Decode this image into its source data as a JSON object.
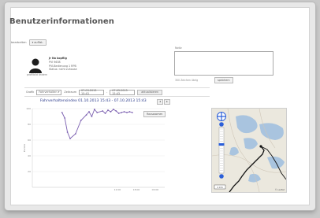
{
  "page": {
    "title": "Benutzerinformationen",
    "edit_label": "bearbeiten",
    "edit_button": "▾ auflist."
  },
  "user": {
    "avatar_label": "profilbild ändern",
    "name": "Jr No kopflig",
    "line2": "PVI 9638",
    "line3": "PVI-Bedienung 1 RPB",
    "line4": "Status: nicht zuhause"
  },
  "notes": {
    "label": "Notiz",
    "hint": "300 Zeichen übrig",
    "button": "speichern"
  },
  "filter": {
    "label": "Grafik",
    "select": "Fahrverhalten ▾",
    "range_label": "Zeitraum",
    "from": "07.03.2013 15:43",
    "dash": "-",
    "to": "07.03.2013 15:43",
    "apply": "aktualisieren"
  },
  "chart_data": {
    "type": "line",
    "title": "Fahrverhaltensindex 01.10.2013 15:43 - 07.10.2013 15:43",
    "ylabel": "Punkte",
    "ylim": [
      0,
      100
    ],
    "yticks": [
      "100",
      "80",
      "60",
      "40",
      "20",
      ""
    ],
    "xticks": [
      "",
      "",
      "",
      "",
      "12:00",
      "18:00",
      "00:00"
    ],
    "x": [
      0.0,
      0.2,
      0.4,
      0.6,
      1.0,
      1.4,
      1.8,
      2.0,
      2.2,
      2.4,
      2.6,
      3.0,
      3.2,
      3.4,
      3.6,
      3.8,
      4.0,
      4.2,
      4.4,
      4.6,
      4.8,
      5.0,
      5.2
    ],
    "values": [
      95,
      88,
      70,
      62,
      68,
      85,
      92,
      96,
      90,
      99,
      95,
      97,
      94,
      98,
      96,
      99,
      97,
      94,
      95,
      96,
      95,
      96,
      95
    ],
    "x_range": [
      -2.2,
      7.6
    ],
    "zoom_out_label": "Rauszoomen",
    "color": "#7b5fb0"
  },
  "nav": {
    "prev": "◂",
    "next": "▸"
  },
  "map": {
    "route_color": "#111111",
    "water_color": "#a9c4df",
    "control_color": "#2b5fd9",
    "attribution": "© Leaflet",
    "scale": "1 km"
  }
}
